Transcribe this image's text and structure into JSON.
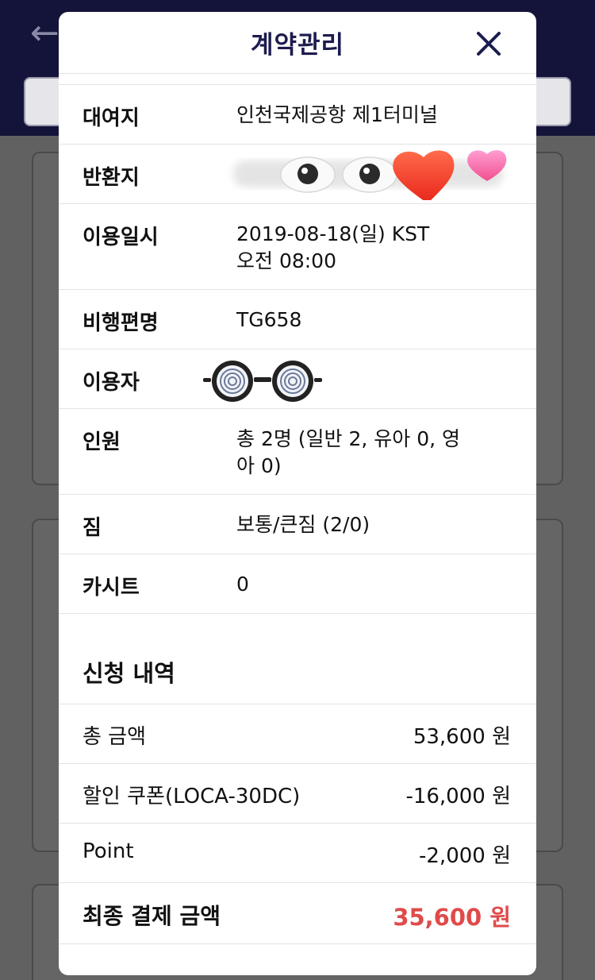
{
  "modal": {
    "title": "계약관리",
    "close_icon": "close-icon"
  },
  "info_rows": [
    {
      "label": "대여지",
      "value": "인천국제공항 제1터미널"
    },
    {
      "label": "반환지",
      "value": ""
    },
    {
      "label": "이용일시",
      "value": "2019-08-18(일) KST\n오전 08:00"
    },
    {
      "label": "비행편명",
      "value": "TG658"
    },
    {
      "label": "이용자",
      "value": ""
    },
    {
      "label": "인원",
      "value": "총 2명 (일반 2, 유아 0, 영\n아 0)"
    },
    {
      "label": "짐",
      "value": "보통/큰짐 (2/0)"
    },
    {
      "label": "카시트",
      "value": "0"
    }
  ],
  "summary": {
    "title": "신청 내역",
    "rows": [
      {
        "label": "총 금액",
        "value": "53,600 원"
      },
      {
        "label": "할인 쿠폰(LOCA-30DC)",
        "value": "-16,000 원"
      },
      {
        "label": "Point",
        "value": "-2,000 원"
      },
      {
        "label": "최종 결제 금액",
        "value": "35,600 원"
      }
    ]
  },
  "colors": {
    "header_bg": "#14143a",
    "title_color": "#1c1c4e",
    "final_amount": "#e04a4a"
  },
  "stickers": {
    "return_location": [
      "googly-eyes-icon",
      "heart-icon",
      "pink-heart-icon"
    ],
    "user": [
      "hypnotic-glasses-icon"
    ]
  }
}
